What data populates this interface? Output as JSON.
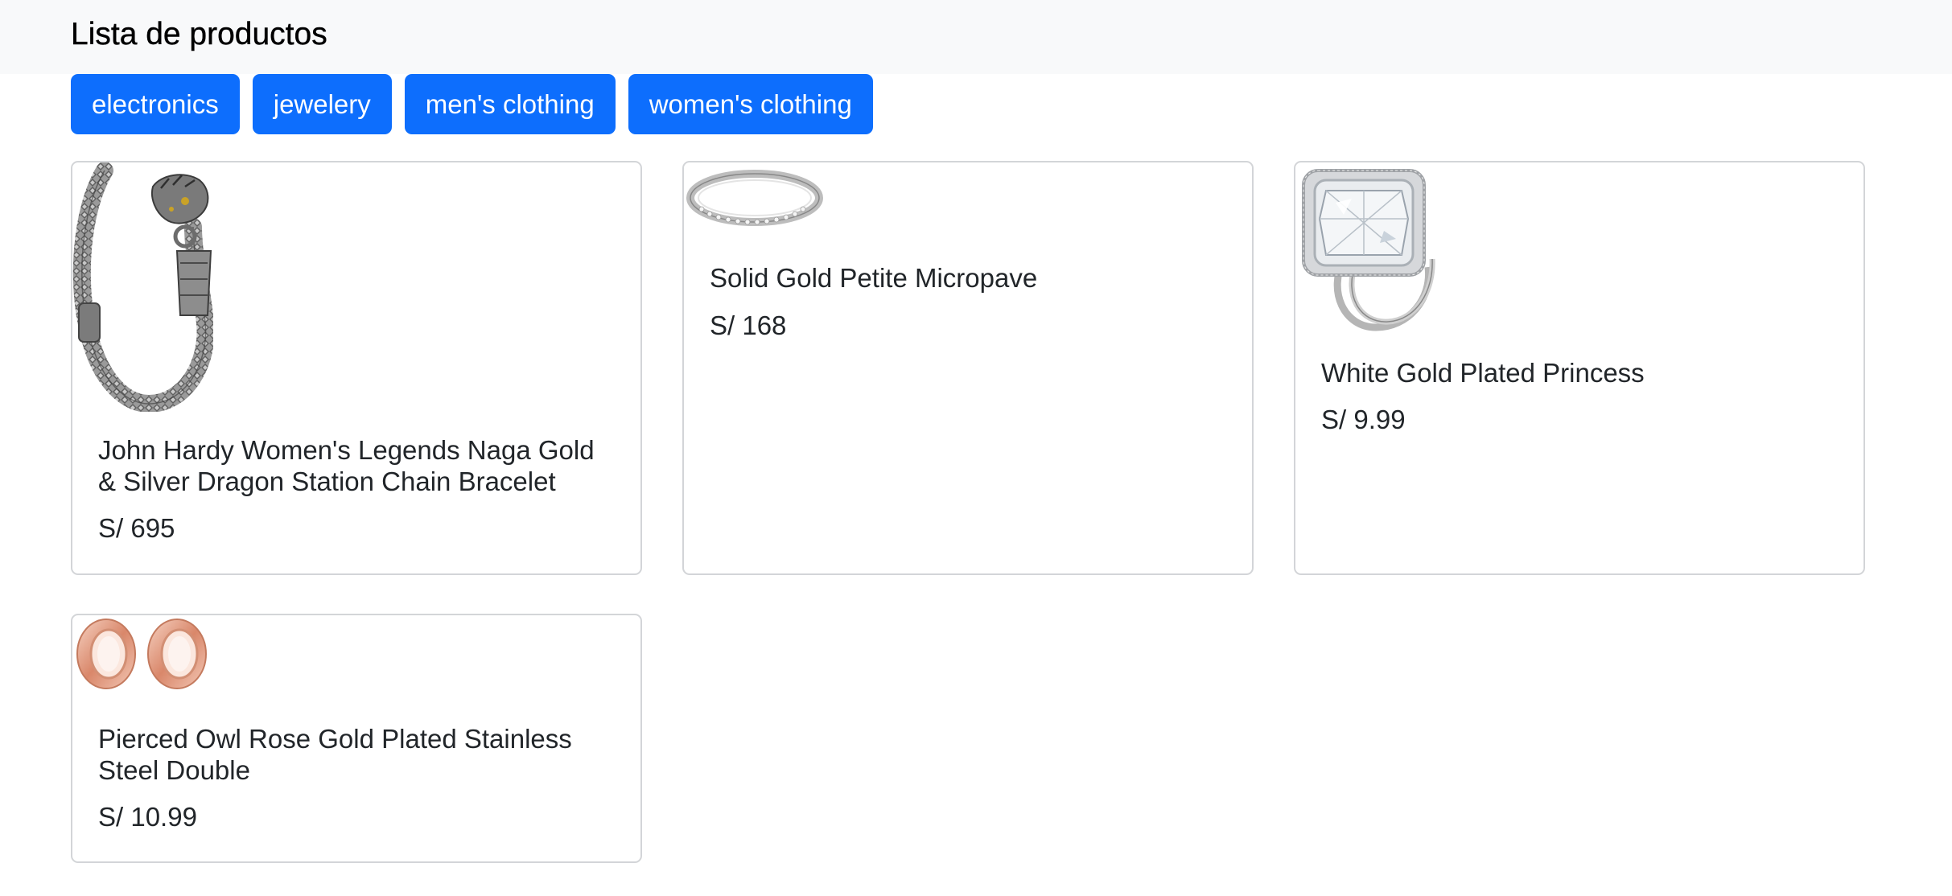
{
  "header": {
    "title": "Lista de productos"
  },
  "categories": [
    "electronics",
    "jewelery",
    "men's clothing",
    "women's clothing"
  ],
  "products": [
    {
      "title": "John Hardy Women's Legends Naga Gold & Silver Dragon Station Chain Bracelet",
      "price": "S/ 695",
      "image_icon": "dragon-chain-bracelet-image"
    },
    {
      "title": "Solid Gold Petite Micropave",
      "price": "S/ 168",
      "image_icon": "micropave-ring-image"
    },
    {
      "title": "White Gold Plated Princess",
      "price": "S/ 9.99",
      "image_icon": "princess-ring-image"
    },
    {
      "title": "Pierced Owl Rose Gold Plated Stainless Steel Double",
      "price": "S/ 10.99",
      "image_icon": "rose-gold-tunnel-plugs-image"
    }
  ],
  "colors": {
    "accent": "#0d6efd",
    "navbar_bg": "#f8f9fa",
    "card_border": "#d3d5d8"
  }
}
